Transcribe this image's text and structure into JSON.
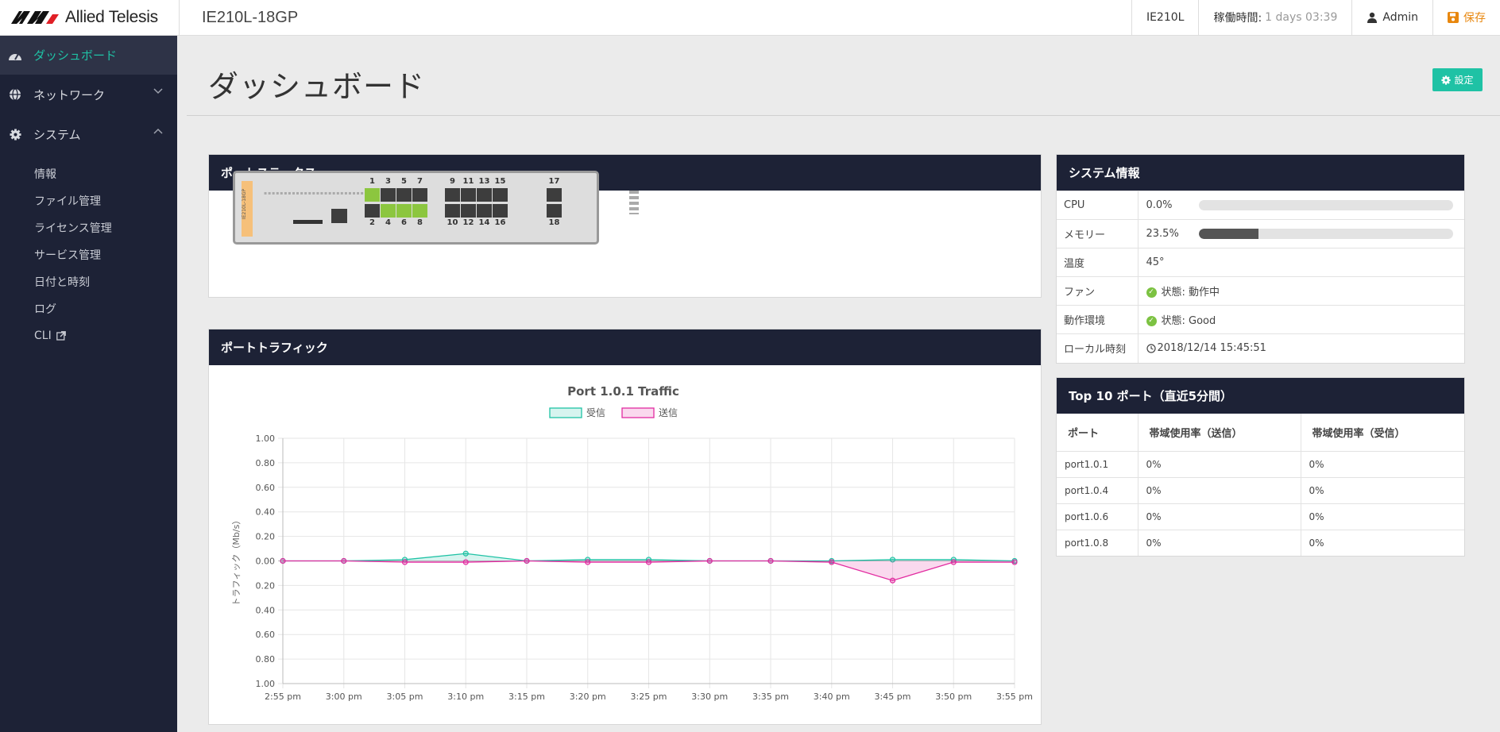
{
  "brand": {
    "name": "Allied Telesis",
    "model": "IE210L-18GP"
  },
  "topbar": {
    "device": "IE210L",
    "uptime_label": "稼働時間:",
    "uptime_value": "1 days 03:39",
    "user": "Admin",
    "save_label": "保存"
  },
  "sidebar": {
    "items": [
      {
        "label": "ダッシュボード",
        "icon": "dashboard-icon"
      },
      {
        "label": "ネットワーク",
        "icon": "globe-icon"
      },
      {
        "label": "システム",
        "icon": "gear-icon"
      }
    ],
    "subitems": [
      "情報",
      "ファイル管理",
      "ライセンス管理",
      "サービス管理",
      "日付と時刻",
      "ログ",
      "CLI"
    ]
  },
  "page": {
    "title": "ダッシュボード",
    "settings_label": "設定"
  },
  "port_status": {
    "title": "ポートステータス",
    "device_label": "IE210L-18GP",
    "ports": [
      {
        "num": "1",
        "up": true
      },
      {
        "num": "2",
        "up": false
      },
      {
        "num": "3",
        "up": false
      },
      {
        "num": "4",
        "up": true
      },
      {
        "num": "5",
        "up": false
      },
      {
        "num": "6",
        "up": true
      },
      {
        "num": "7",
        "up": false
      },
      {
        "num": "8",
        "up": true
      },
      {
        "num": "9",
        "up": false
      },
      {
        "num": "10",
        "up": false
      },
      {
        "num": "11",
        "up": false
      },
      {
        "num": "12",
        "up": false
      },
      {
        "num": "13",
        "up": false
      },
      {
        "num": "14",
        "up": false
      },
      {
        "num": "15",
        "up": false
      },
      {
        "num": "16",
        "up": false
      },
      {
        "num": "17",
        "up": false
      },
      {
        "num": "18",
        "up": false
      }
    ]
  },
  "port_traffic": {
    "title": "ポートトラフィック"
  },
  "chart_data": {
    "type": "line",
    "title": "Port 1.0.1 Traffic",
    "ylabel": "トラフィック（Mb/s）",
    "xlabel": "",
    "categories": [
      "2:55 pm",
      "3:00 pm",
      "3:05 pm",
      "3:10 pm",
      "3:15 pm",
      "3:20 pm",
      "3:25 pm",
      "3:30 pm",
      "3:35 pm",
      "3:40 pm",
      "3:45 pm",
      "3:50 pm",
      "3:55 pm"
    ],
    "ytick_labels": [
      "1.00",
      "0.80",
      "0.60",
      "0.40",
      "0.20",
      "0.00",
      "0.20",
      "0.40",
      "0.60",
      "0.80",
      "1.00"
    ],
    "ylim": [
      -1,
      1
    ],
    "grid": true,
    "legend": "top-center",
    "series": [
      {
        "name": "受信",
        "color": "#1fc2a5",
        "values": [
          0,
          0,
          0.01,
          0.06,
          0,
          0.01,
          0.01,
          0,
          0,
          0,
          0.01,
          0.01,
          0
        ]
      },
      {
        "name": "送信",
        "color": "#e22ba0",
        "values": [
          0,
          0,
          -0.01,
          -0.01,
          0,
          -0.01,
          -0.01,
          0,
          0,
          -0.01,
          -0.16,
          -0.01,
          -0.01
        ]
      }
    ]
  },
  "system_info": {
    "title": "システム情報",
    "cpu": {
      "label": "CPU",
      "value": "0.0%",
      "fraction": 0.0
    },
    "memory": {
      "label": "メモリー",
      "value": "23.5%",
      "fraction": 0.235
    },
    "temp": {
      "label": "温度",
      "value": "45°"
    },
    "fan": {
      "label": "ファン",
      "value": "状態: 動作中"
    },
    "env": {
      "label": "動作環境",
      "value": "状態: Good"
    },
    "time": {
      "label": "ローカル時刻",
      "value": "2018/12/14 15:45:51"
    }
  },
  "top10": {
    "title": "Top 10 ポート（直近5分間）",
    "headers": [
      "ポート",
      "帯域使用率（送信）",
      "帯域使用率（受信）"
    ],
    "rows": [
      [
        "port1.0.1",
        "0%",
        "0%"
      ],
      [
        "port1.0.4",
        "0%",
        "0%"
      ],
      [
        "port1.0.6",
        "0%",
        "0%"
      ],
      [
        "port1.0.8",
        "0%",
        "0%"
      ]
    ]
  }
}
